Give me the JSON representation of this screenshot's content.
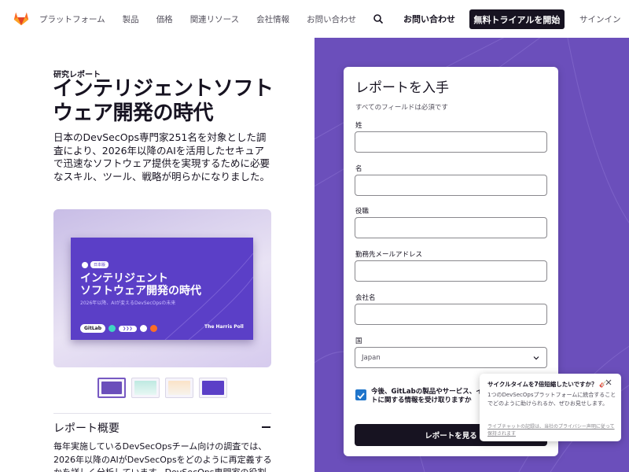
{
  "colors": {
    "brand_purple": "#6b4fbb",
    "dark": "#171321",
    "checkbox_blue": "#1f75cb"
  },
  "header": {
    "logo_icon": "gitlab-tanuki-icon",
    "nav": [
      "プラットフォーム",
      "製品",
      "価格",
      "関連リソース",
      "会社情報",
      "お問い合わせ"
    ],
    "search_icon": "search-icon",
    "contact_label": "お問い合わせ",
    "trial_label": "無料トライアルを開始",
    "signin_label": "サインイン"
  },
  "hero": {
    "eyebrow": "研究レポート",
    "title": "インテリジェントソフトウェア開発の時代",
    "lead": "日本のDevSecOps専門家251名を対象とした調査により、2026年以降のAIを活用したセキュアで迅速なソフトウェア提供を実現するために必要なスキル、ツール、戦略が明らかになりました。"
  },
  "cover": {
    "badge": "日本版",
    "title_line1": "インテリジェント",
    "title_line2": "ソフトウェア開発の時代",
    "subtitle": "2026年以降、AIが変えるDevSecOpsの未来",
    "gitlab_label": "GitLab",
    "arrows_label": "❯❯❯",
    "harris_label": "The Harris Poll"
  },
  "thumbnails": {
    "count": 4,
    "active_index": 0
  },
  "overview": {
    "title": "レポート概要",
    "text": "毎年実施しているDevSecOpsチーム向けの調査では、2026年以降のAIがDevSecOpsをどのように再定義するかを詳しく分析しています。DevSecOps専門家の役割は"
  },
  "form": {
    "title": "レポートを入手",
    "required_note": "すべてのフィールドは必須です",
    "fields": [
      {
        "label": "姓",
        "value": ""
      },
      {
        "label": "名",
        "value": ""
      },
      {
        "label": "役職",
        "value": ""
      },
      {
        "label": "勤務先メールアドレス",
        "value": ""
      },
      {
        "label": "会社名",
        "value": ""
      }
    ],
    "country_label": "国",
    "country_value": "Japan",
    "consent_label": "今後、GitLabの製品やサービス、イベントに関する情報を受け取りますか",
    "submit_label": "レポートを見る"
  },
  "chat": {
    "title": "サイクルタイムを7倍短縮したいですか？ 🎸",
    "body": "1つのDevSecOpsプラットフォームに統合することでどのように助けられるか、ぜひお見せします。",
    "footer": "ライブチャットの記録は、当社のプライバシー声明に従って保持されます"
  }
}
